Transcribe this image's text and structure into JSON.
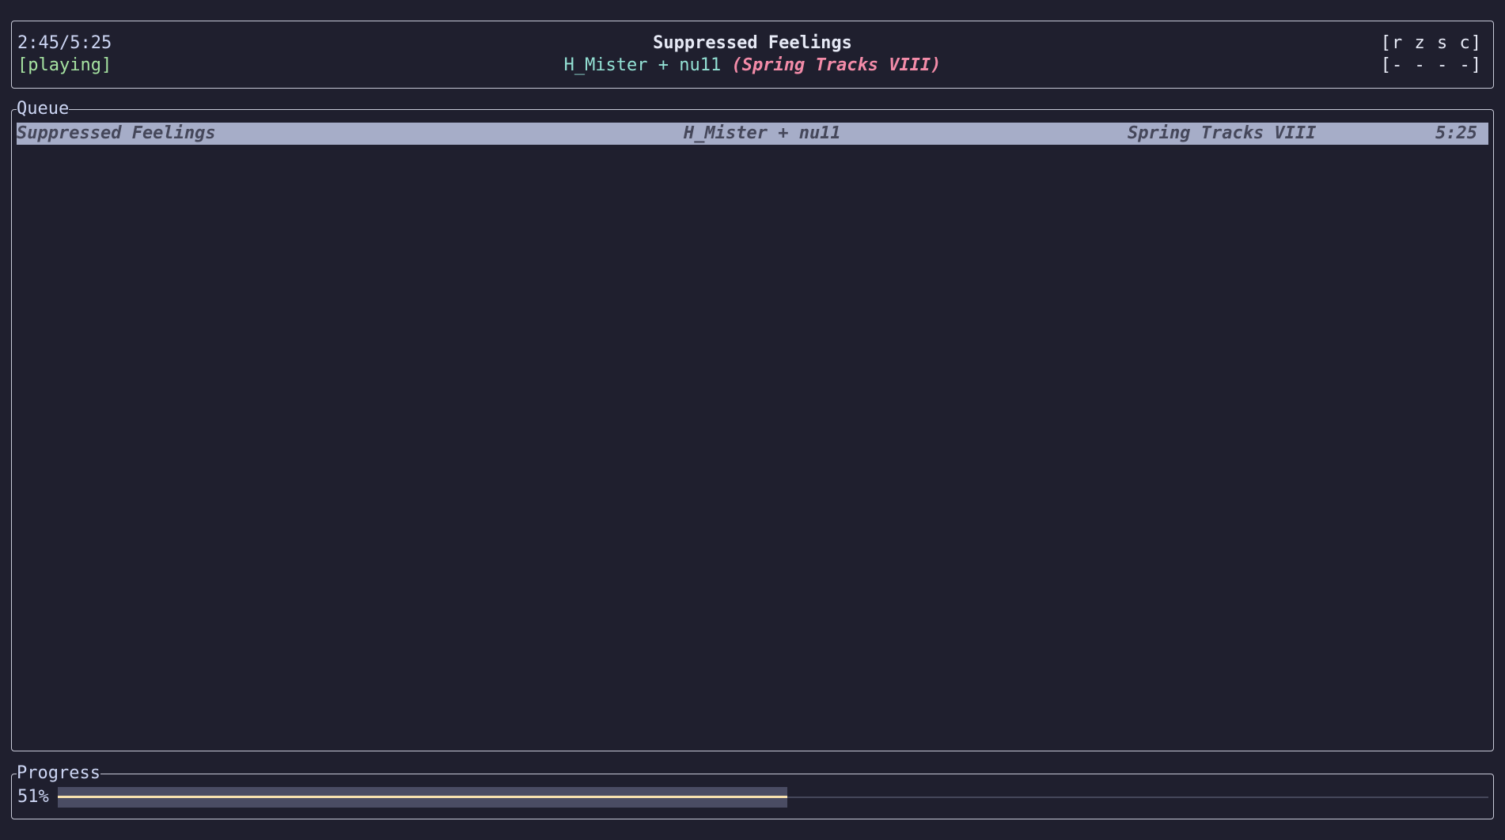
{
  "header": {
    "elapsed": "2:45/5:25",
    "state": "[playing]",
    "song_title": "Suppressed Feelings",
    "artist": "H_Mister + nu11",
    "album": "(Spring Tracks VIII)",
    "flags_top": "[r z s c]",
    "flags_bottom": "[- - - -]"
  },
  "queue": {
    "title": "Queue",
    "rows": [
      {
        "title": "Suppressed Feelings",
        "artist": "H_Mister + nu11",
        "album": "Spring Tracks VIII",
        "duration": "5:25"
      }
    ]
  },
  "progress": {
    "title": "Progress",
    "percent_label": "51%",
    "fraction": 0.51
  },
  "colors": {
    "background": "#1f1f2e",
    "accent_state": "#a6e3a1",
    "accent_artist": "#94e2d5",
    "accent_album": "#f38ba8",
    "progress_fill": "#f9e2af"
  }
}
